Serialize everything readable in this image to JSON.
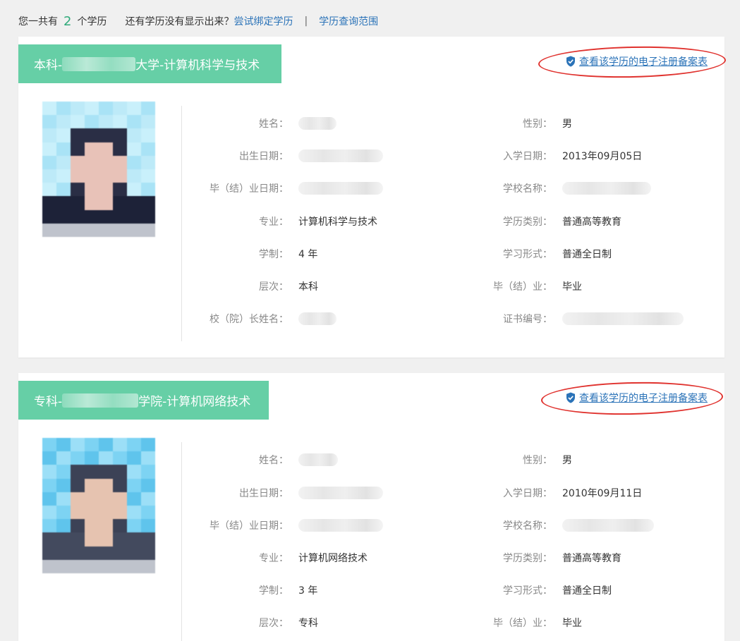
{
  "summary": {
    "prefix": "您一共有",
    "count": "2",
    "suffix": "个学历",
    "question": "还有学历没有显示出来？",
    "bind_link": "尝试绑定学历",
    "separator": "|",
    "scope_link": "学历查询范围"
  },
  "colors": {
    "header_green": "#66cfa6",
    "link_blue": "#2b73b8",
    "count_green": "#2faa7a",
    "annotation_red": "#e0322e"
  },
  "labels": {
    "name": "姓名：",
    "gender": "性别：",
    "birth": "出生日期：",
    "enroll": "入学日期：",
    "grad_date": "毕（结）业日期：",
    "school": "学校名称：",
    "major": "专业：",
    "edu_type": "学历类别：",
    "duration": "学制：",
    "study_form": "学习形式：",
    "level": "层次：",
    "grad_status": "毕（结）业：",
    "president": "校（院）长姓名：",
    "cert_no": "证书编号："
  },
  "records": [
    {
      "title_prefix": "本科-",
      "title_suffix": "大学-计算机科学与技术",
      "reg_link": "查看该学历的电子注册备案表",
      "name": "",
      "gender": "男",
      "birth": "",
      "enroll": "2013年09月05日",
      "grad_date": "",
      "school": "",
      "major": "计算机科学与技术",
      "edu_type": "普通高等教育",
      "duration": "4 年",
      "study_form": "普通全日制",
      "level": "本科",
      "grad_status": "毕业",
      "president": "",
      "cert_no": ""
    },
    {
      "title_prefix": "专科-",
      "title_suffix": "学院-计算机网络技术",
      "reg_link": "查看该学历的电子注册备案表",
      "name": "",
      "gender": "男",
      "birth": "",
      "enroll": "2010年09月11日",
      "grad_date": "",
      "school": "",
      "major": "计算机网络技术",
      "edu_type": "普通高等教育",
      "duration": "3 年",
      "study_form": "普通全日制",
      "level": "专科",
      "grad_status": "毕业"
    }
  ]
}
